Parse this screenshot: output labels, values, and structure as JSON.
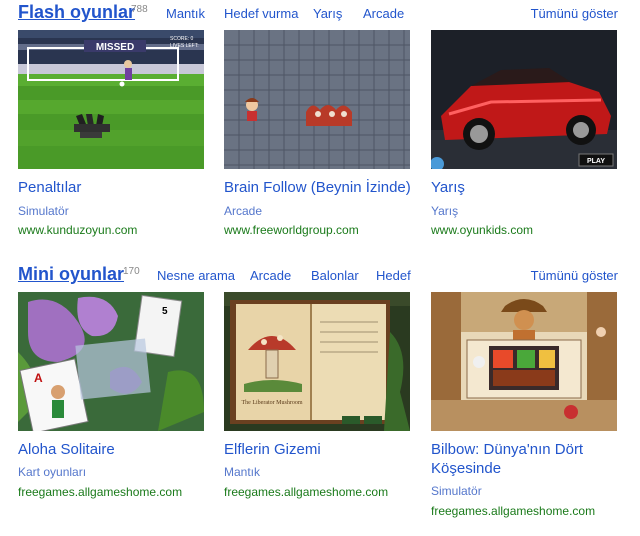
{
  "flash": {
    "title": "Flash oyunlar",
    "count": "788",
    "categories": [
      "Mantık",
      "Hedef vurma",
      "Yarış",
      "Arcade"
    ],
    "show_all": "Tümünü göster",
    "games": [
      {
        "title": "Penaltılar",
        "category": "Simulatör",
        "url": "www.kunduzoyun.com",
        "overlay_text": "MISSED",
        "score_text": "SCORE: 0",
        "lives_text": "LIVES LEFT:"
      },
      {
        "title": "Brain Follow (Beynin İzinde)",
        "category": "Arcade",
        "url": "www.freeworldgroup.com"
      },
      {
        "title": "Yarış",
        "category": "Yarış",
        "url": "www.oyunkids.com",
        "badge_text": "PLAY"
      }
    ]
  },
  "mini": {
    "title": "Mini oyunlar",
    "count": "170",
    "categories": [
      "Nesne arama",
      "Arcade",
      "Balonlar",
      "Hedef"
    ],
    "show_all": "Tümünü göster",
    "games": [
      {
        "title": "Aloha Solitaire",
        "category": "Kart oyunları",
        "url": "freegames.allgameshome.com",
        "card_rank": "A",
        "card_rank2": "5"
      },
      {
        "title": "Elflerin Gizemi",
        "category": "Mantık",
        "url": "freegames.allgameshome.com",
        "book_title": "The Liberator Mushroom"
      },
      {
        "title": "Bilbow: Dünya'nın Dört Köşesinde",
        "category": "Simulatör",
        "url": "freegames.allgameshome.com"
      }
    ]
  },
  "colors": {
    "link": "#2255cc",
    "url": "#1a7a1a",
    "count": "#888888"
  },
  "icons": {
    "play_badge": "play-icon"
  }
}
